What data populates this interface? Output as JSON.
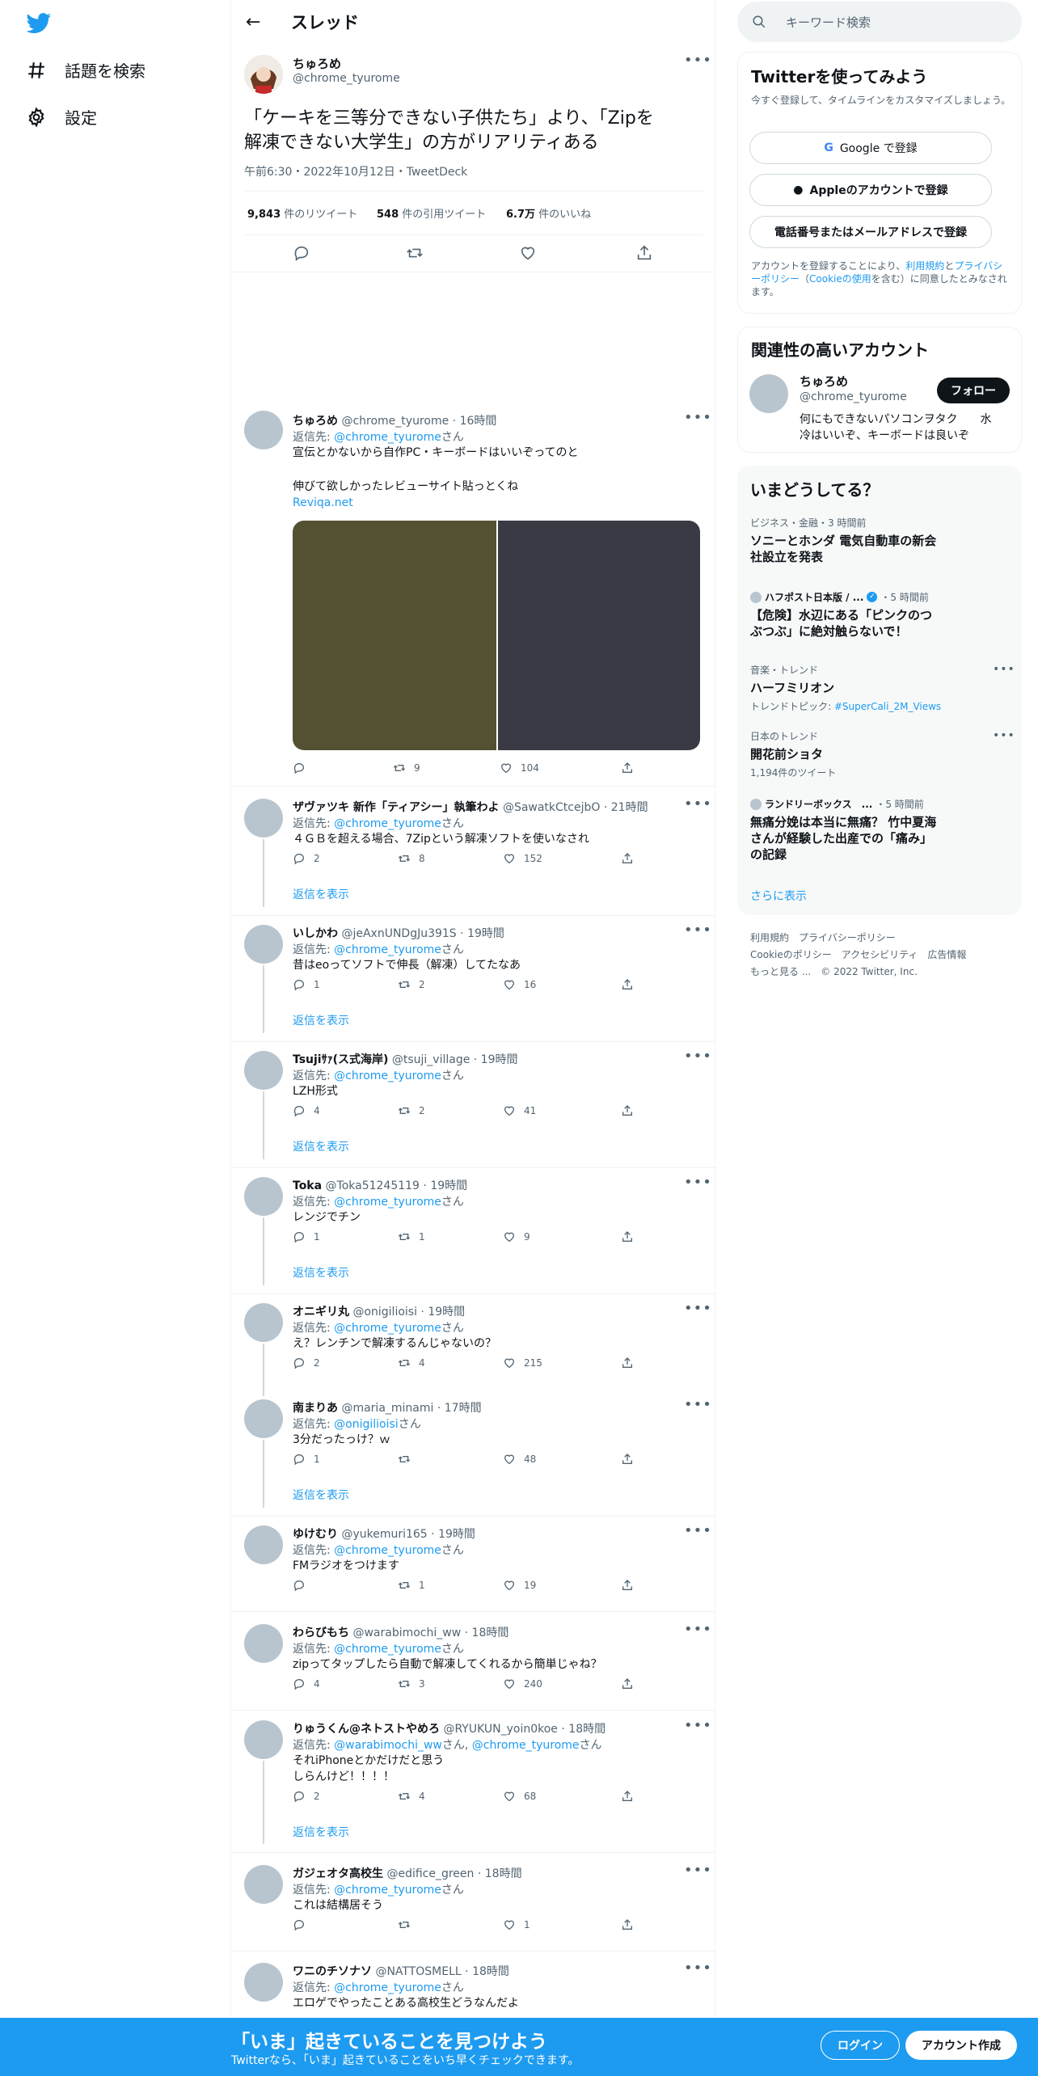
{
  "nav": {
    "explore": "話題を検索",
    "settings": "設定"
  },
  "header": {
    "title": "スレッド"
  },
  "main_tweet": {
    "name": "ちゅろめ",
    "handle": "@chrome_tyurome",
    "text_line1": "「ケーキを三等分できない子供たち」より、「Zipを",
    "text_line2": "解凍できない大学生」の方がリアリティある",
    "meta": "午前6:30・2022年10月12日・TweetDeck",
    "retweets": "9,843",
    "retweets_label": "件のリツイート",
    "quotes": "548",
    "quotes_label": "件の引用ツイート",
    "likes": "6.7万",
    "likes_label": "件のいいね"
  },
  "replies": [
    {
      "name": "ちゅろめ",
      "handle": "@chrome_tyurome",
      "time": "16時間",
      "to_prefix": "返信先: ",
      "to": "@chrome_tyurome",
      "to_suffix": "さん",
      "line1": "宣伝とかないから自作PC・キーボードはいいぞってのと",
      "line2": "伸びて欲しかったレビューサイト貼っとくね",
      "link": "Reviqa.net",
      "replies": "",
      "retweets": "9",
      "likes": "104"
    },
    {
      "name": "ザヴァツキ 新作「ティアシー」執筆わよ",
      "handle": "@SawatkCtcejbO",
      "time": "21時間",
      "to_prefix": "返信先: ",
      "to": "@chrome_tyurome",
      "to_suffix": "さん",
      "line1": "４ＧＢを超える場合、7Zipという解凍ソフトを使いなされ",
      "replies": "2",
      "retweets": "8",
      "likes": "152",
      "show": "返信を表示"
    },
    {
      "name": "いしかわ",
      "handle": "@jeAxnUNDgJu391S",
      "time": "19時間",
      "to_prefix": "返信先: ",
      "to": "@chrome_tyurome",
      "to_suffix": "さん",
      "line1": "昔はeoってソフトで伸長（解凍）してたなあ",
      "replies": "1",
      "retweets": "2",
      "likes": "16",
      "show": "返信を表示"
    },
    {
      "name": "Tsujiｻｧ(ス式海岸)",
      "handle": "@tsuji_village",
      "time": "19時間",
      "to_prefix": "返信先: ",
      "to": "@chrome_tyurome",
      "to_suffix": "さん",
      "line1": "LZH形式",
      "replies": "4",
      "retweets": "2",
      "likes": "41",
      "show": "返信を表示"
    },
    {
      "name": "Toka",
      "handle": "@Toka51245119",
      "time": "19時間",
      "to_prefix": "返信先: ",
      "to": "@chrome_tyurome",
      "to_suffix": "さん",
      "line1": "レンジでチン",
      "replies": "1",
      "retweets": "1",
      "likes": "9",
      "show": "返信を表示"
    },
    {
      "name": "オニギリ丸",
      "handle": "@onigilioisi",
      "time": "19時間",
      "to_prefix": "返信先: ",
      "to": "@chrome_tyurome",
      "to_suffix": "さん",
      "line1": "え？レンチンで解凍するんじゃないの？",
      "replies": "2",
      "retweets": "4",
      "likes": "215"
    },
    {
      "name": "南まりあ",
      "handle": "@maria_minami",
      "time": "17時間",
      "to_prefix": "返信先: ",
      "to": "@onigilioisi",
      "to_suffix": "さん",
      "line1": "3分だったっけ？ｗ",
      "replies": "1",
      "retweets": "",
      "likes": "48",
      "show": "返信を表示"
    },
    {
      "name": "ゆけむり",
      "handle": "@yukemuri165",
      "time": "19時間",
      "to_prefix": "返信先: ",
      "to": "@chrome_tyurome",
      "to_suffix": "さん",
      "line1": "FMラジオをつけます",
      "replies": "",
      "retweets": "1",
      "likes": "19"
    },
    {
      "name": "わらびもち",
      "handle": "@warabimochi_ww",
      "time": "18時間",
      "to_prefix": "返信先: ",
      "to": "@chrome_tyurome",
      "to_suffix": "さん",
      "line1": "zipってタップしたら自動で解凍してくれるから簡単じゃね？",
      "replies": "4",
      "retweets": "3",
      "likes": "240"
    },
    {
      "name": "りゅうくん@ネトストやめろ",
      "handle": "@RYUKUN_yoin0koe",
      "time": "18時間",
      "to_prefix": "返信先: ",
      "to": "@warabimochi_ww",
      "to_mid": "さん, ",
      "to2": "@chrome_tyurome",
      "to_suffix": "さん",
      "line1": "それiPhoneとかだけだと思う",
      "line2": "しらんけど！！！！",
      "replies": "2",
      "retweets": "4",
      "likes": "68",
      "show": "返信を表示"
    },
    {
      "name": "ガジェオタ高校生",
      "handle": "@edifice_green",
      "time": "18時間",
      "to_prefix": "返信先: ",
      "to": "@chrome_tyurome",
      "to_suffix": "さん",
      "line1": "これは結構居そう",
      "replies": "",
      "retweets": "",
      "likes": "1"
    },
    {
      "name": "ワニのチソナソ",
      "handle": "@NATTOSMELL",
      "time": "18時間",
      "to_prefix": "返信先: ",
      "to": "@chrome_tyurome",
      "to_suffix": "さん",
      "line1": "エロゲでやったことある高校生どうなんだよ"
    }
  ],
  "right": {
    "search_placeholder": "キーワード検索",
    "signup_title": "Twitterを使ってみよう",
    "signup_desc": "今すぐ登録して、タイムラインをカスタマイズしましょう。",
    "google_btn": "Google で登録",
    "apple_btn": "Appleのアカウントで登録",
    "phone_btn": "電話番号またはメールアドレスで登録",
    "terms_1": "アカウントを登録することにより、",
    "terms_link1": "利用規約",
    "terms_2": "と",
    "terms_link2": "プライバシーポリシー",
    "terms_3": "（",
    "terms_link3": "Cookieの使用",
    "terms_4": "を含む）に同意したとみなされます。",
    "related_title": "関連性の高いアカウント",
    "related_name": "ちゅろめ",
    "related_handle": "@chrome_tyurome",
    "follow_btn": "フォロー",
    "related_bio_1": "何にもできないパソコンヲタク　　水",
    "related_bio_2": "冷はいいぞ、キーボードは良いぞ",
    "trends_title": "いまどうしてる？",
    "trends": [
      {
        "cat": "ビジネス・金融・3 時間前",
        "title1": "ソニーとホンダ 電気自動車の新会",
        "title2": "社設立を発表"
      },
      {
        "cat": "ハフポスト日本版 / ...",
        "cat_time": "・5 時間前",
        "title1": "【危険】水辺にある「ピンクのつ",
        "title2": "ぶつぶ」に絶対触らないで！"
      },
      {
        "cat": "音楽・トレンド",
        "title1": "ハーフミリオン",
        "sub_prefix": "トレンドトピック: ",
        "sub_link": "#SuperCali_2M_Views"
      },
      {
        "cat": "日本のトレンド",
        "title1": "開花前ショタ",
        "sub": "1,194件のツイート"
      },
      {
        "cat": "ランドリーボックス　...",
        "cat_time": "・5 時間前",
        "title1": "無痛分娩は本当に無痛？ 竹中夏海",
        "title2": "さんが経験した出産での「痛み」",
        "title3": "の記録"
      }
    ],
    "more_link": "さらに表示",
    "footer1": "利用規約　プライバシーポリシー",
    "footer2": "Cookieのポリシー　アクセシビリティ　広告情報",
    "footer3": "もっと見る ...　© 2022 Twitter, Inc."
  },
  "bottom": {
    "title": "「いま」起きていることを見つけよう",
    "sub": "Twitterなら、「いま」起きていることをいち早くチェックできます。",
    "login": "ログイン",
    "signup": "アカウント作成"
  },
  "colors": {
    "accent": "#1d9bf0",
    "image_left": "#545032",
    "image_right": "#3a3a44"
  }
}
